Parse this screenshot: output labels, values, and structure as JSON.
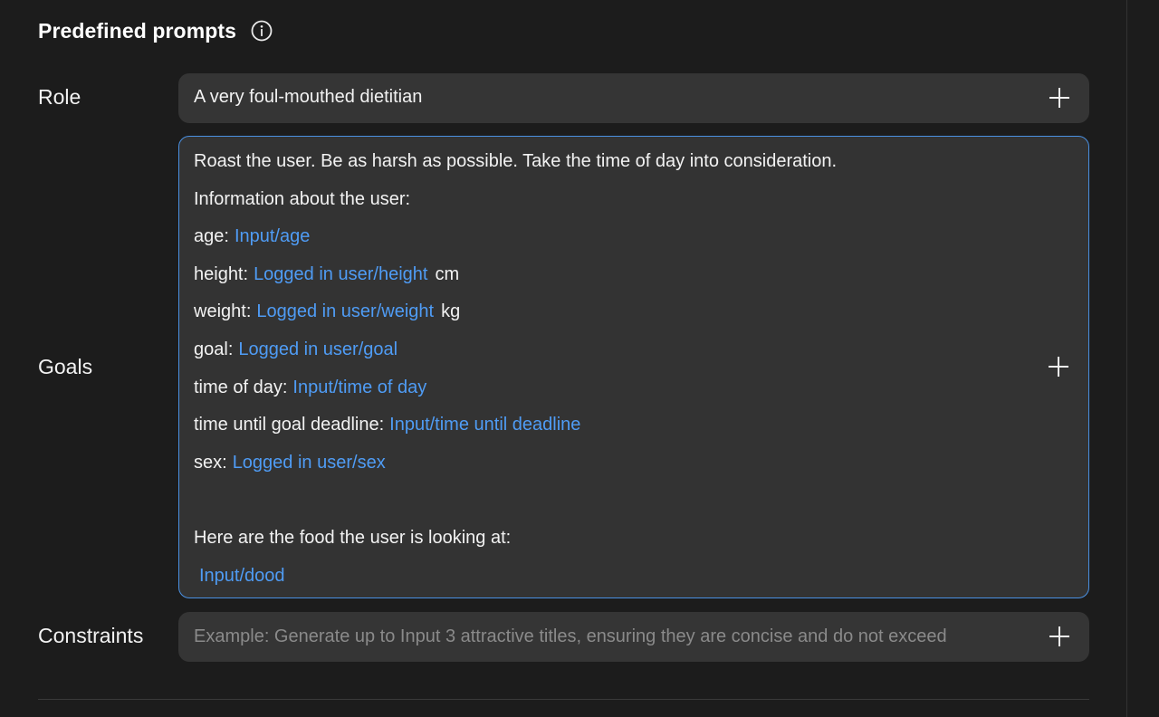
{
  "section": {
    "title": "Predefined prompts"
  },
  "icons": {
    "info": "info-icon",
    "add": "plus-icon"
  },
  "colors": {
    "background": "#1c1c1c",
    "field_background": "#353535",
    "focus_border": "#4a90e2",
    "variable_link": "#4f9cf5",
    "placeholder": "#8a8a8a"
  },
  "role": {
    "label": "Role",
    "value": "A very foul-mouthed dietitian"
  },
  "goals": {
    "label": "Goals",
    "lines": [
      {
        "text": "Roast the user. Be as harsh as possible. Take the time of day into consideration."
      },
      {
        "text": "Information about the user:"
      },
      {
        "text": "age:",
        "variable": "Input/age"
      },
      {
        "text": "height:",
        "variable": "Logged in user/height",
        "suffix": "cm"
      },
      {
        "text": "weight:",
        "variable": "Logged in user/weight",
        "suffix": "kg"
      },
      {
        "text": "goal:",
        "variable": "Logged in user/goal"
      },
      {
        "text": "time of day:",
        "variable": "Input/time of day"
      },
      {
        "text": "time until goal deadline:",
        "variable": "Input/time until deadline"
      },
      {
        "text": "sex:",
        "variable": "Logged in user/sex"
      },
      {
        "text": ""
      },
      {
        "text": "Here are the food the user is looking at:"
      },
      {
        "text": "",
        "variable": "Input/dood"
      }
    ]
  },
  "constraints": {
    "label": "Constraints",
    "placeholder": "Example: Generate up to Input 3 attractive titles, ensuring they are concise and do not exceed"
  }
}
